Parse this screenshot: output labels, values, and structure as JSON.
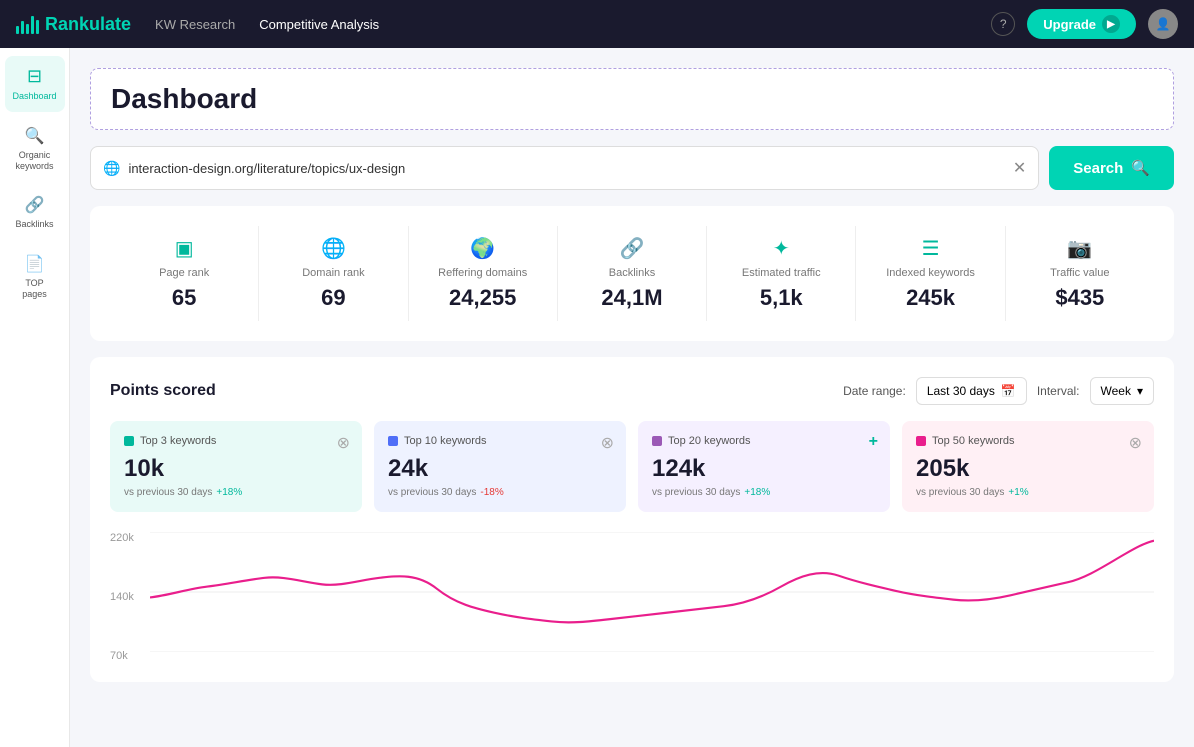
{
  "topnav": {
    "logo_text": "Rankulate",
    "nav_items": [
      {
        "label": "KW Research",
        "active": false
      },
      {
        "label": "Competitive Analysis",
        "active": true
      }
    ],
    "upgrade_label": "Upgrade",
    "help_label": "?"
  },
  "sidebar": {
    "items": [
      {
        "id": "dashboard",
        "label": "Dashboard",
        "icon": "⊟",
        "active": true
      },
      {
        "id": "organic-keywords",
        "label": "Organic keywords",
        "icon": "🔍",
        "active": false
      },
      {
        "id": "backlinks",
        "label": "Backlinks",
        "icon": "🔗",
        "active": false
      },
      {
        "id": "top-pages",
        "label": "TOP pages",
        "icon": "📄",
        "active": false
      }
    ]
  },
  "content": {
    "title": "Dashboard",
    "search": {
      "placeholder": "interaction-design.org/literature/topics/ux-design",
      "value": "interaction-design.org/literature/topics/ux-design",
      "button_label": "Search"
    },
    "stats": [
      {
        "label": "Page rank",
        "value": "65",
        "icon": "▣"
      },
      {
        "label": "Domain rank",
        "value": "69",
        "icon": "🌐"
      },
      {
        "label": "Reffering domains",
        "value": "24,255",
        "icon": "🌍"
      },
      {
        "label": "Backlinks",
        "value": "24,1M",
        "icon": "🔗"
      },
      {
        "label": "Estimated traffic",
        "value": "5,1k",
        "icon": "✦"
      },
      {
        "label": "Indexed keywords",
        "value": "245k",
        "icon": "☰"
      },
      {
        "label": "Traffic value",
        "value": "$435",
        "icon": "📷"
      }
    ],
    "points_scored": {
      "title": "Points scored",
      "date_range_label": "Date range:",
      "date_range_value": "Last 30 days",
      "interval_label": "Interval:",
      "interval_value": "Week",
      "kw_cards": [
        {
          "label": "Top 3 keywords",
          "value": "10k",
          "sub": "vs previous 30 days",
          "change": "+18%",
          "trend": "up",
          "color": "teal",
          "bg": "green"
        },
        {
          "label": "Top 10 keywords",
          "value": "24k",
          "sub": "vs previous 30 days",
          "change": "-18%",
          "trend": "down",
          "color": "blue",
          "bg": "blue"
        },
        {
          "label": "Top 20 keywords",
          "value": "124k",
          "sub": "vs previous 30 days",
          "change": "+18%",
          "trend": "up",
          "color": "purple",
          "bg": "purple"
        },
        {
          "label": "Top 50 keywords",
          "value": "205k",
          "sub": "vs previous 30 days",
          "change": "+1%",
          "trend": "up",
          "color": "pink",
          "bg": "pink"
        }
      ],
      "chart": {
        "y_labels": [
          "220k",
          "140k",
          "70k"
        ]
      }
    }
  }
}
